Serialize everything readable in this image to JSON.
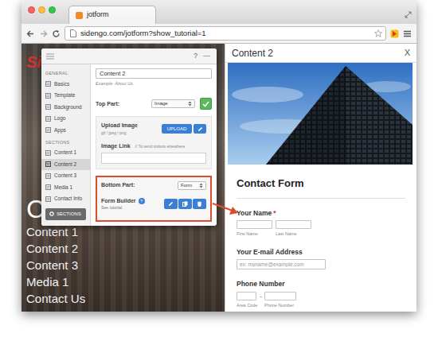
{
  "browser": {
    "tab": {
      "title": "jotform"
    },
    "url": "sidengo.com/jotform?show_tutorial=1"
  },
  "site": {
    "logo": "Si",
    "heading": "C",
    "nav": [
      {
        "label": "Content 1"
      },
      {
        "label": "Content 2"
      },
      {
        "label": "Content 3"
      },
      {
        "label": "Media 1"
      },
      {
        "label": "Contact Us"
      }
    ]
  },
  "editor": {
    "help": "?",
    "minimize": "—",
    "sidebar": {
      "groups": [
        {
          "title": "GENERAL",
          "items": [
            {
              "label": "Basics",
              "selected": false
            },
            {
              "label": "Template",
              "selected": false
            },
            {
              "label": "Background",
              "selected": false
            },
            {
              "label": "Logo",
              "selected": false
            },
            {
              "label": "Apps",
              "selected": false
            }
          ]
        },
        {
          "title": "SECTIONS",
          "items": [
            {
              "label": "Content 1",
              "selected": false
            },
            {
              "label": "Content 2",
              "selected": true
            },
            {
              "label": "Content 3",
              "selected": false
            },
            {
              "label": "Media 1",
              "selected": false
            },
            {
              "label": "Contact Info",
              "selected": false
            }
          ]
        }
      ],
      "button": "SECTIONS"
    },
    "title": {
      "value": "Content 2",
      "hint": "Example: About Us"
    },
    "top_part": {
      "label": "Top Part:",
      "value": "Image"
    },
    "upload": {
      "label": "Upload Image",
      "formats": "gif / jpeg / png",
      "button": "UPLOAD"
    },
    "image_link": {
      "label": "Image Link",
      "hint": "// To send visitors elsewhere"
    },
    "bottom_part": {
      "label": "Bottom Part:",
      "value": "Form"
    },
    "form_builder": {
      "label": "Form Builder",
      "help": "?",
      "note": "See",
      "link": "tutorial."
    }
  },
  "preview": {
    "title": "Content 2",
    "close": "X",
    "form": {
      "title": "Contact Form",
      "fields": [
        {
          "kind": "name",
          "label": "Your Name",
          "required": true,
          "required_mark": "*",
          "sublabels": [
            "First Name",
            "Last Name"
          ]
        },
        {
          "kind": "email",
          "label": "Your E-mail Address",
          "required": false,
          "placeholder": "ex: myname@example.com"
        },
        {
          "kind": "phone",
          "label": "Phone Number",
          "required": false,
          "separator": "-",
          "sublabels": [
            "Area Code",
            "Phone Number"
          ]
        }
      ]
    }
  }
}
